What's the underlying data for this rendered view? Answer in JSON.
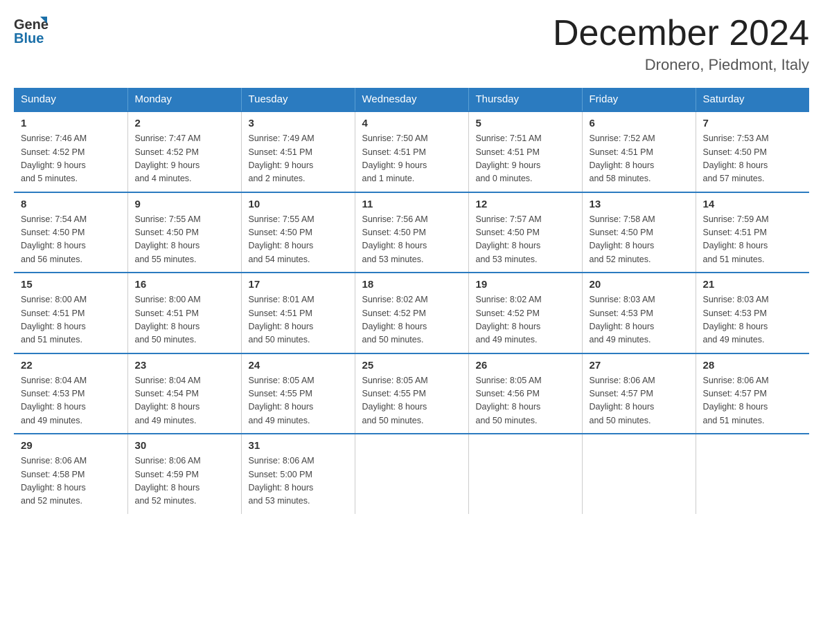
{
  "logo": {
    "general_text": "General",
    "blue_text": "Blue"
  },
  "title": "December 2024",
  "subtitle": "Dronero, Piedmont, Italy",
  "weekdays": [
    "Sunday",
    "Monday",
    "Tuesday",
    "Wednesday",
    "Thursday",
    "Friday",
    "Saturday"
  ],
  "weeks": [
    [
      {
        "day": "1",
        "sunrise": "Sunrise: 7:46 AM",
        "sunset": "Sunset: 4:52 PM",
        "daylight": "Daylight: 9 hours",
        "daylight2": "and 5 minutes."
      },
      {
        "day": "2",
        "sunrise": "Sunrise: 7:47 AM",
        "sunset": "Sunset: 4:52 PM",
        "daylight": "Daylight: 9 hours",
        "daylight2": "and 4 minutes."
      },
      {
        "day": "3",
        "sunrise": "Sunrise: 7:49 AM",
        "sunset": "Sunset: 4:51 PM",
        "daylight": "Daylight: 9 hours",
        "daylight2": "and 2 minutes."
      },
      {
        "day": "4",
        "sunrise": "Sunrise: 7:50 AM",
        "sunset": "Sunset: 4:51 PM",
        "daylight": "Daylight: 9 hours",
        "daylight2": "and 1 minute."
      },
      {
        "day": "5",
        "sunrise": "Sunrise: 7:51 AM",
        "sunset": "Sunset: 4:51 PM",
        "daylight": "Daylight: 9 hours",
        "daylight2": "and 0 minutes."
      },
      {
        "day": "6",
        "sunrise": "Sunrise: 7:52 AM",
        "sunset": "Sunset: 4:51 PM",
        "daylight": "Daylight: 8 hours",
        "daylight2": "and 58 minutes."
      },
      {
        "day": "7",
        "sunrise": "Sunrise: 7:53 AM",
        "sunset": "Sunset: 4:50 PM",
        "daylight": "Daylight: 8 hours",
        "daylight2": "and 57 minutes."
      }
    ],
    [
      {
        "day": "8",
        "sunrise": "Sunrise: 7:54 AM",
        "sunset": "Sunset: 4:50 PM",
        "daylight": "Daylight: 8 hours",
        "daylight2": "and 56 minutes."
      },
      {
        "day": "9",
        "sunrise": "Sunrise: 7:55 AM",
        "sunset": "Sunset: 4:50 PM",
        "daylight": "Daylight: 8 hours",
        "daylight2": "and 55 minutes."
      },
      {
        "day": "10",
        "sunrise": "Sunrise: 7:55 AM",
        "sunset": "Sunset: 4:50 PM",
        "daylight": "Daylight: 8 hours",
        "daylight2": "and 54 minutes."
      },
      {
        "day": "11",
        "sunrise": "Sunrise: 7:56 AM",
        "sunset": "Sunset: 4:50 PM",
        "daylight": "Daylight: 8 hours",
        "daylight2": "and 53 minutes."
      },
      {
        "day": "12",
        "sunrise": "Sunrise: 7:57 AM",
        "sunset": "Sunset: 4:50 PM",
        "daylight": "Daylight: 8 hours",
        "daylight2": "and 53 minutes."
      },
      {
        "day": "13",
        "sunrise": "Sunrise: 7:58 AM",
        "sunset": "Sunset: 4:50 PM",
        "daylight": "Daylight: 8 hours",
        "daylight2": "and 52 minutes."
      },
      {
        "day": "14",
        "sunrise": "Sunrise: 7:59 AM",
        "sunset": "Sunset: 4:51 PM",
        "daylight": "Daylight: 8 hours",
        "daylight2": "and 51 minutes."
      }
    ],
    [
      {
        "day": "15",
        "sunrise": "Sunrise: 8:00 AM",
        "sunset": "Sunset: 4:51 PM",
        "daylight": "Daylight: 8 hours",
        "daylight2": "and 51 minutes."
      },
      {
        "day": "16",
        "sunrise": "Sunrise: 8:00 AM",
        "sunset": "Sunset: 4:51 PM",
        "daylight": "Daylight: 8 hours",
        "daylight2": "and 50 minutes."
      },
      {
        "day": "17",
        "sunrise": "Sunrise: 8:01 AM",
        "sunset": "Sunset: 4:51 PM",
        "daylight": "Daylight: 8 hours",
        "daylight2": "and 50 minutes."
      },
      {
        "day": "18",
        "sunrise": "Sunrise: 8:02 AM",
        "sunset": "Sunset: 4:52 PM",
        "daylight": "Daylight: 8 hours",
        "daylight2": "and 50 minutes."
      },
      {
        "day": "19",
        "sunrise": "Sunrise: 8:02 AM",
        "sunset": "Sunset: 4:52 PM",
        "daylight": "Daylight: 8 hours",
        "daylight2": "and 49 minutes."
      },
      {
        "day": "20",
        "sunrise": "Sunrise: 8:03 AM",
        "sunset": "Sunset: 4:53 PM",
        "daylight": "Daylight: 8 hours",
        "daylight2": "and 49 minutes."
      },
      {
        "day": "21",
        "sunrise": "Sunrise: 8:03 AM",
        "sunset": "Sunset: 4:53 PM",
        "daylight": "Daylight: 8 hours",
        "daylight2": "and 49 minutes."
      }
    ],
    [
      {
        "day": "22",
        "sunrise": "Sunrise: 8:04 AM",
        "sunset": "Sunset: 4:53 PM",
        "daylight": "Daylight: 8 hours",
        "daylight2": "and 49 minutes."
      },
      {
        "day": "23",
        "sunrise": "Sunrise: 8:04 AM",
        "sunset": "Sunset: 4:54 PM",
        "daylight": "Daylight: 8 hours",
        "daylight2": "and 49 minutes."
      },
      {
        "day": "24",
        "sunrise": "Sunrise: 8:05 AM",
        "sunset": "Sunset: 4:55 PM",
        "daylight": "Daylight: 8 hours",
        "daylight2": "and 49 minutes."
      },
      {
        "day": "25",
        "sunrise": "Sunrise: 8:05 AM",
        "sunset": "Sunset: 4:55 PM",
        "daylight": "Daylight: 8 hours",
        "daylight2": "and 50 minutes."
      },
      {
        "day": "26",
        "sunrise": "Sunrise: 8:05 AM",
        "sunset": "Sunset: 4:56 PM",
        "daylight": "Daylight: 8 hours",
        "daylight2": "and 50 minutes."
      },
      {
        "day": "27",
        "sunrise": "Sunrise: 8:06 AM",
        "sunset": "Sunset: 4:57 PM",
        "daylight": "Daylight: 8 hours",
        "daylight2": "and 50 minutes."
      },
      {
        "day": "28",
        "sunrise": "Sunrise: 8:06 AM",
        "sunset": "Sunset: 4:57 PM",
        "daylight": "Daylight: 8 hours",
        "daylight2": "and 51 minutes."
      }
    ],
    [
      {
        "day": "29",
        "sunrise": "Sunrise: 8:06 AM",
        "sunset": "Sunset: 4:58 PM",
        "daylight": "Daylight: 8 hours",
        "daylight2": "and 52 minutes."
      },
      {
        "day": "30",
        "sunrise": "Sunrise: 8:06 AM",
        "sunset": "Sunset: 4:59 PM",
        "daylight": "Daylight: 8 hours",
        "daylight2": "and 52 minutes."
      },
      {
        "day": "31",
        "sunrise": "Sunrise: 8:06 AM",
        "sunset": "Sunset: 5:00 PM",
        "daylight": "Daylight: 8 hours",
        "daylight2": "and 53 minutes."
      },
      {
        "day": "",
        "sunrise": "",
        "sunset": "",
        "daylight": "",
        "daylight2": ""
      },
      {
        "day": "",
        "sunrise": "",
        "sunset": "",
        "daylight": "",
        "daylight2": ""
      },
      {
        "day": "",
        "sunrise": "",
        "sunset": "",
        "daylight": "",
        "daylight2": ""
      },
      {
        "day": "",
        "sunrise": "",
        "sunset": "",
        "daylight": "",
        "daylight2": ""
      }
    ]
  ]
}
